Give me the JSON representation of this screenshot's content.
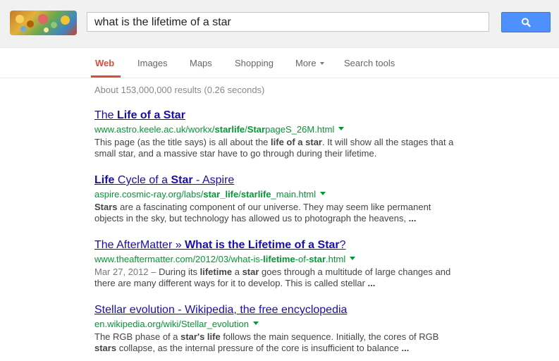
{
  "search": {
    "query": "what is the lifetime of a star"
  },
  "tabs": [
    "Web",
    "Images",
    "Maps",
    "Shopping",
    "More",
    "Search tools"
  ],
  "stats": "About 153,000,000 results (0.26 seconds)",
  "results": [
    {
      "title": [
        "The ",
        "Life of a Star",
        ""
      ],
      "url": [
        "www.astro.keele.ac.uk/workx/",
        "starlife",
        "/",
        "Star",
        "pageS_26M.html"
      ],
      "date": "",
      "snippet": [
        "This page (as the title says) is all about the ",
        "life of a star",
        ". It will show all the stages that a small star, and a massive star have to go through during their lifetime.",
        "",
        ""
      ]
    },
    {
      "title": [
        "",
        "Life",
        " Cycle of a ",
        "Star",
        " - Aspire"
      ],
      "url": [
        "aspire.cosmic-ray.org/labs/",
        "star_life",
        "/",
        "starlife",
        "_main.html"
      ],
      "date": "",
      "snippet": [
        "",
        "Stars",
        " are a fascinating component of our universe. They may seem like permanent objects in the sky, but technology has allowed us to photograph the heavens, ",
        "...",
        ""
      ]
    },
    {
      "title": [
        "The AfterMatter » ",
        "What is the Lifetime of a Star",
        "?"
      ],
      "url": [
        "www.theaftermatter.com/2012/03/what-is-",
        "lifetime",
        "-of-",
        "star",
        ".html"
      ],
      "date": "Mar 27, 2012 – ",
      "snippet": [
        "During its ",
        "lifetime",
        " a ",
        "star",
        " goes through a multitude of large changes and there are many different ways for it to develop. This is called stellar ",
        "..."
      ]
    },
    {
      "title": [
        "Stellar evolution - Wikipedia, the free encyclopedia"
      ],
      "url": [
        "en.wikipedia.org/wiki/Stellar_evolution"
      ],
      "date": "",
      "snippet": [
        "The RGB phase of a ",
        "star's life",
        " follows the main sequence. Initially, the cores of RGB ",
        "stars",
        " collapse, as the internal pressure of the core is insufficient to balance ",
        "..."
      ]
    }
  ],
  "colors": {
    "link": "#1a0dab",
    "url": "#009933",
    "tab_active": "#dd4b39",
    "button": "#4d90fe"
  }
}
